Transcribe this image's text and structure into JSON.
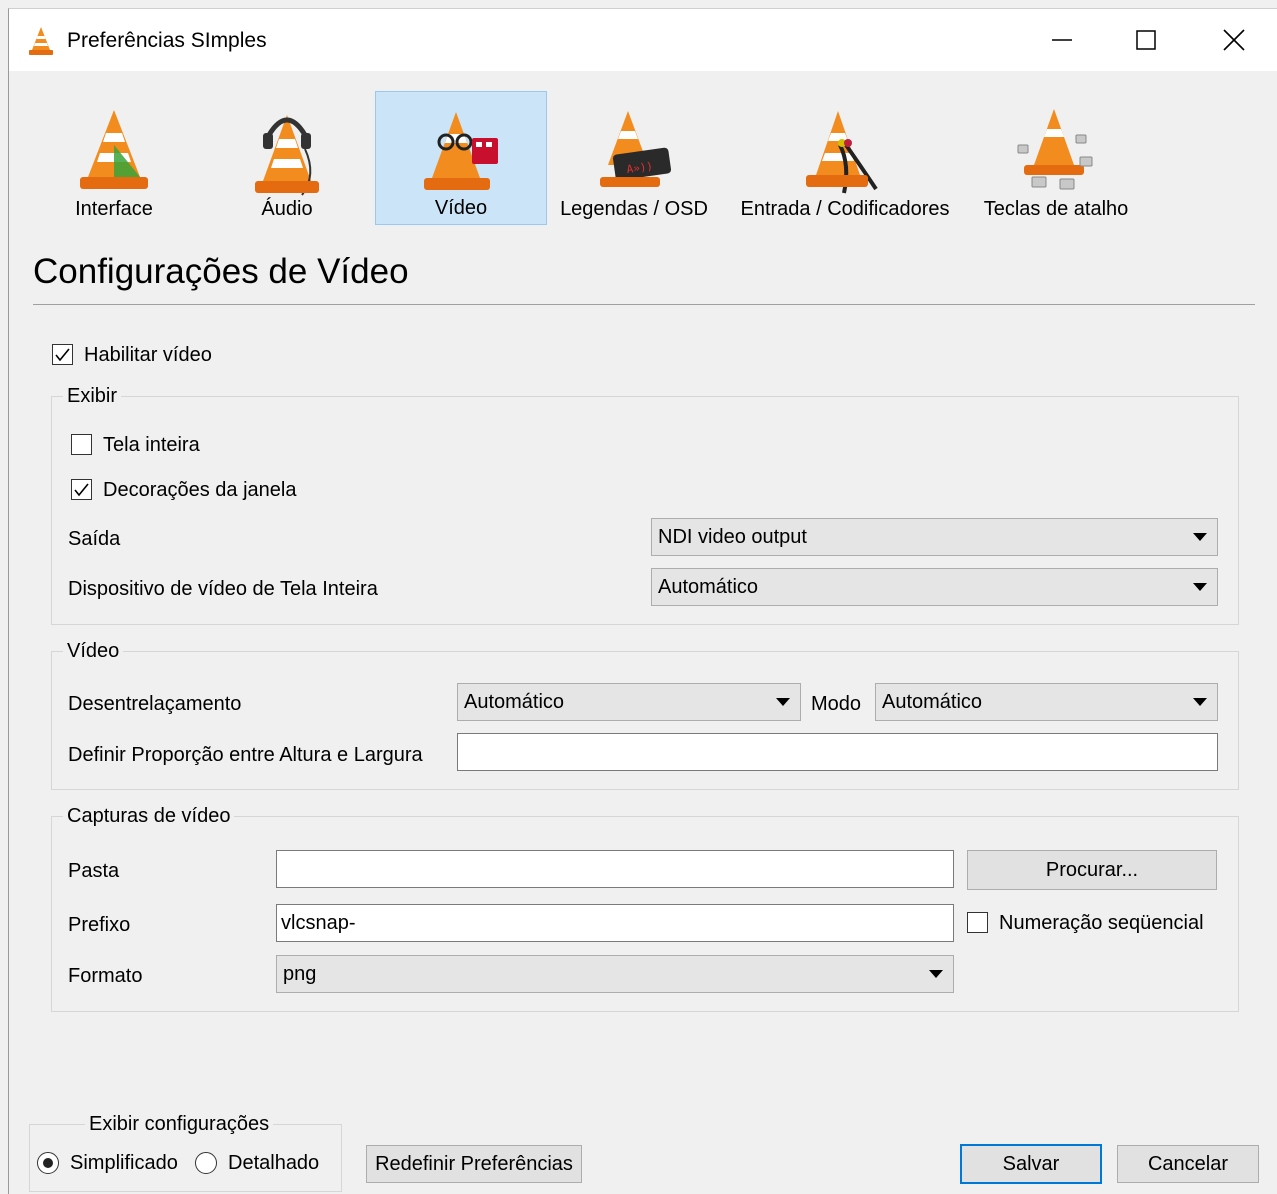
{
  "window": {
    "title": "Preferências SImples",
    "icon": "vlc-cone-icon",
    "controls": [
      "minimize-icon",
      "maximize-icon",
      "close-icon"
    ]
  },
  "categories": [
    {
      "label": "Interface",
      "icon": "interface-cone-icon",
      "selected": false
    },
    {
      "label": "Áudio",
      "icon": "audio-headphones-cone-icon",
      "selected": false
    },
    {
      "label": "Vídeo",
      "icon": "video-glasses-cone-icon",
      "selected": true
    },
    {
      "label": "Legendas / OSD",
      "icon": "subtitles-display-cone-icon",
      "selected": false
    },
    {
      "label": "Entrada / Codificadores",
      "icon": "input-cables-cone-icon",
      "selected": false
    },
    {
      "label": "Teclas de atalho",
      "icon": "hotkeys-keyboard-cone-icon",
      "selected": false
    }
  ],
  "section_title": "Configurações de Vídeo",
  "enable_video": {
    "label": "Habilitar vídeo",
    "checked": true
  },
  "display_group": {
    "title": "Exibir",
    "fullscreen": {
      "label": "Tela inteira",
      "checked": false
    },
    "window_decorations": {
      "label": "Decorações da janela",
      "checked": true
    },
    "output": {
      "label": "Saída",
      "value": "NDI video output"
    },
    "fullscreen_device": {
      "label": "Dispositivo de vídeo de Tela Inteira",
      "value": "Automático"
    }
  },
  "video_group": {
    "title": "Vídeo",
    "deinterlace": {
      "label": "Desentrelaçamento",
      "value": "Automático"
    },
    "mode": {
      "label": "Modo",
      "value": "Automático"
    },
    "aspect_ratio": {
      "label": "Definir Proporção entre Altura e Largura",
      "value": ""
    }
  },
  "snapshots_group": {
    "title": "Capturas de vídeo",
    "folder": {
      "label": "Pasta",
      "value": ""
    },
    "browse_button": "Procurar...",
    "prefix": {
      "label": "Prefixo",
      "value": "vlcsnap-"
    },
    "sequential": {
      "label": "Numeração seqüencial",
      "checked": false
    },
    "format": {
      "label": "Formato",
      "value": "png"
    }
  },
  "show_settings": {
    "title": "Exibir configurações",
    "simple": {
      "label": "Simplificado",
      "selected": true
    },
    "advanced": {
      "label": "Detalhado",
      "selected": false
    }
  },
  "buttons": {
    "reset": "Redefinir Preferências",
    "save": "Salvar",
    "cancel": "Cancelar"
  },
  "colors": {
    "selected_category_bg": "#cce4f7",
    "default_button_border": "#0078d7",
    "vlc_orange": "#f28c1e"
  }
}
